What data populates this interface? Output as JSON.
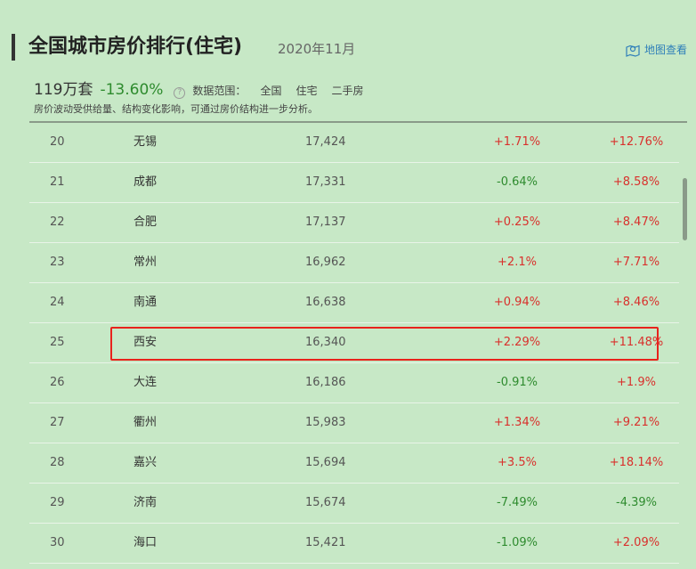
{
  "header": {
    "title": "全国城市房价排行(住宅)",
    "period": "2020年11月",
    "map_link": "地图查看"
  },
  "summary": {
    "count": "119万套",
    "change": "-13.60%",
    "help_glyph": "?",
    "scope_label": "数据范围：",
    "scope_items": [
      "全国",
      "住宅",
      "二手房"
    ],
    "note": "房价波动受供给量、结构变化影响，可通过房价结构进一步分析。"
  },
  "colors": {
    "up": "#d9302c",
    "down": "#2e8b2e",
    "highlight": "#e8231c",
    "background": "#c7e8c6"
  },
  "rows": [
    {
      "rank": "20",
      "city": "无锡",
      "price": "17,424",
      "mom": "+1.71%",
      "yoy": "+12.76%"
    },
    {
      "rank": "21",
      "city": "成都",
      "price": "17,331",
      "mom": "-0.64%",
      "yoy": "+8.58%"
    },
    {
      "rank": "22",
      "city": "合肥",
      "price": "17,137",
      "mom": "+0.25%",
      "yoy": "+8.47%"
    },
    {
      "rank": "23",
      "city": "常州",
      "price": "16,962",
      "mom": "+2.1%",
      "yoy": "+7.71%"
    },
    {
      "rank": "24",
      "city": "南通",
      "price": "16,638",
      "mom": "+0.94%",
      "yoy": "+8.46%"
    },
    {
      "rank": "25",
      "city": "西安",
      "price": "16,340",
      "mom": "+2.29%",
      "yoy": "+11.48%"
    },
    {
      "rank": "26",
      "city": "大连",
      "price": "16,186",
      "mom": "-0.91%",
      "yoy": "+1.9%"
    },
    {
      "rank": "27",
      "city": "衢州",
      "price": "15,983",
      "mom": "+1.34%",
      "yoy": "+9.21%"
    },
    {
      "rank": "28",
      "city": "嘉兴",
      "price": "15,694",
      "mom": "+3.5%",
      "yoy": "+18.14%"
    },
    {
      "rank": "29",
      "city": "济南",
      "price": "15,674",
      "mom": "-7.49%",
      "yoy": "-4.39%"
    },
    {
      "rank": "30",
      "city": "海口",
      "price": "15,421",
      "mom": "-1.09%",
      "yoy": "+2.09%"
    }
  ]
}
